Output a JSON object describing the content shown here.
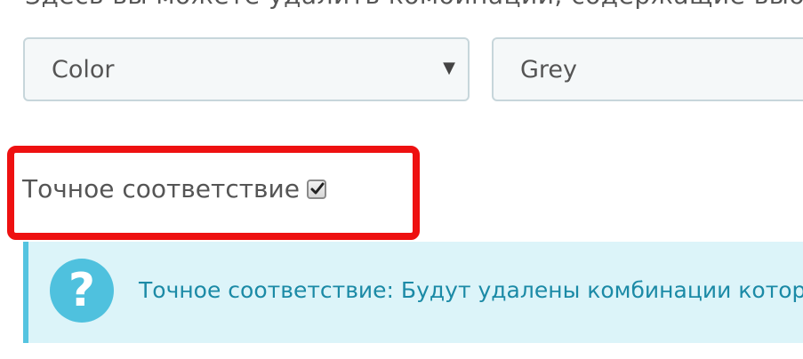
{
  "top_text": "Здесь вы можете удалить комбинации, содержащие выбранный атрибут",
  "attribute_select": {
    "selected": "Color"
  },
  "value_field": {
    "value": "Grey"
  },
  "exact_match": {
    "label": "Точное соответствие",
    "checked": true
  },
  "info_alert": {
    "icon": "question-circle-icon",
    "text": "Точное соответствие: Будут удалены комбинации которые"
  },
  "colors": {
    "highlight": "#ee1111",
    "info_bg": "#dcf4f9",
    "info_text": "#1b8aa6",
    "info_icon": "#4fc1de"
  }
}
